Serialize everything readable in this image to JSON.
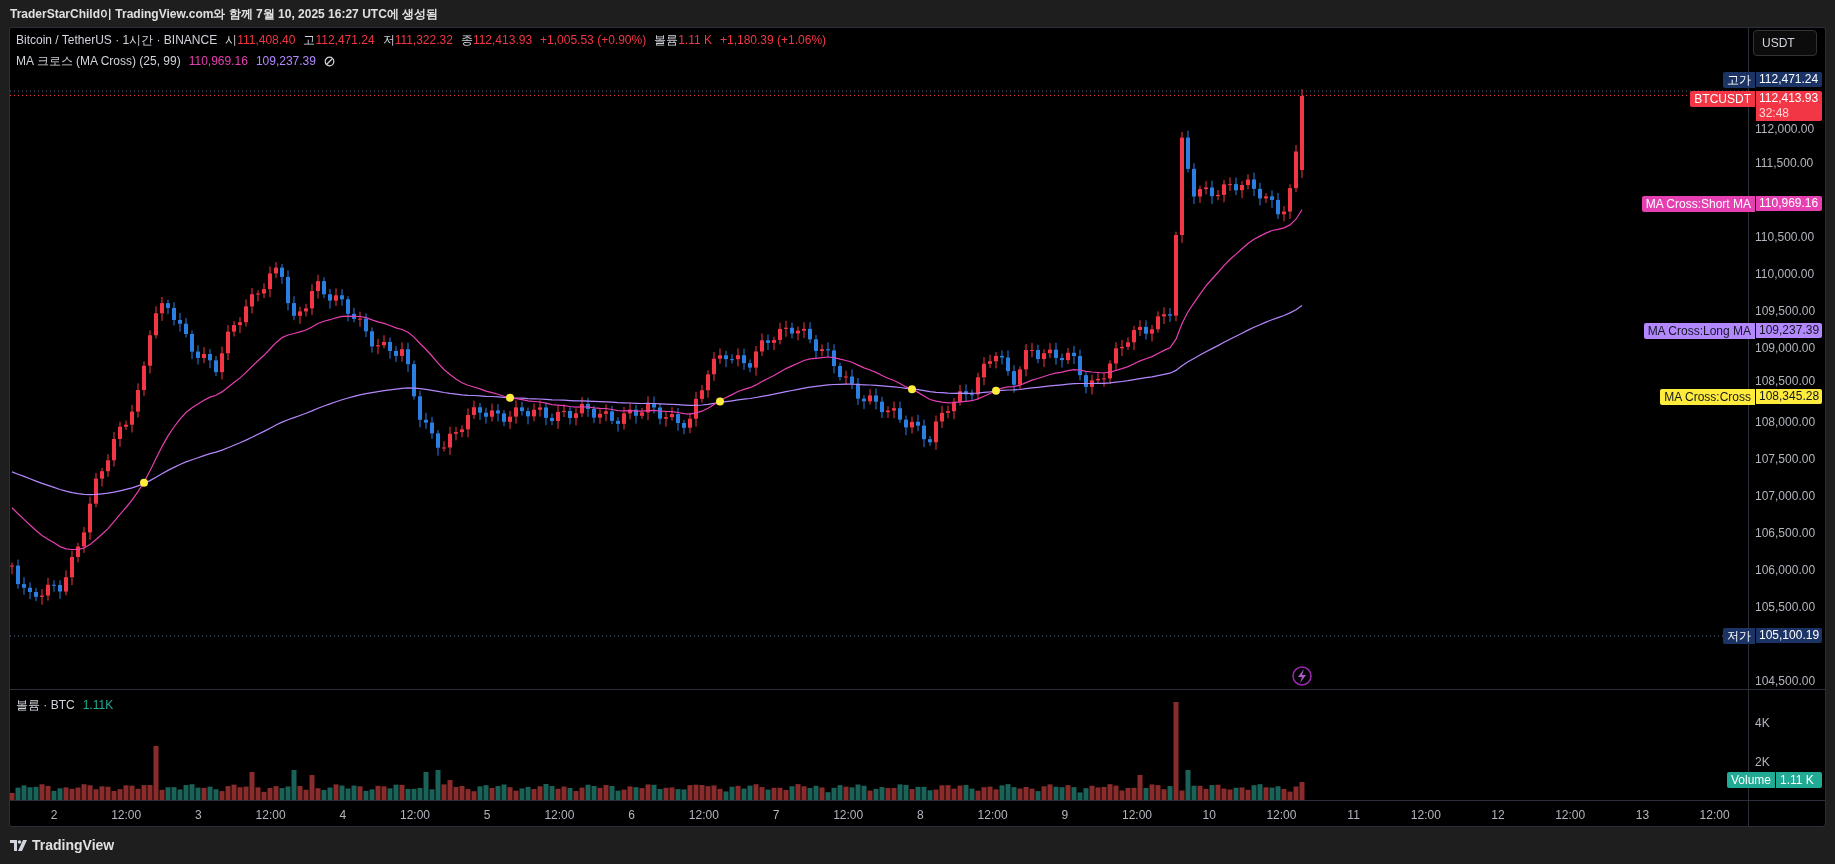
{
  "title_bar": {
    "text": "TraderStarChild이 TradingView.com와 함께 7월 10, 2025 16:27 UTC에 생성됨"
  },
  "legend": {
    "symbol": "Bitcoin / TetherUS · 1시간 · BINANCE",
    "ohlc": [
      {
        "label": "시",
        "value": "111,408.40"
      },
      {
        "label": "고",
        "value": "112,471.24"
      },
      {
        "label": "저",
        "value": "111,322.32"
      },
      {
        "label": "종",
        "value": "112,413.93"
      }
    ],
    "change": "+1,005.53 (+0.90%)",
    "volume_label": "볼륨",
    "volume": "1.11 K",
    "volume_change": "+1,180.39 (+1.06%)"
  },
  "indicator": {
    "name": "MA 크로스 (MA Cross) (25, 99)",
    "values": [
      {
        "value": "110,969.16",
        "color": "#e53fb1"
      },
      {
        "value": "109,237.39",
        "color": "#b388ff"
      }
    ]
  },
  "currency_button": "USDT",
  "price_axis": {
    "ticks": [
      "112,000.00",
      "111,500.00",
      "110,500.00",
      "110,000.00",
      "109,500.00",
      "109,000.00",
      "108,500.00",
      "108,000.00",
      "107,500.00",
      "107,000.00",
      "106,500.00",
      "106,000.00",
      "105,500.00",
      "104,500.00"
    ]
  },
  "price_tags": [
    {
      "label": "고가",
      "value": "112,471.24",
      "color": "#1c3366"
    },
    {
      "label": "BTCUSDT",
      "value": "112,413.93",
      "countdown": "32:48",
      "color": "#f23645"
    },
    {
      "label": "MA Cross:Short MA",
      "value": "110,969.16",
      "color": "#e53fb1"
    },
    {
      "label": "MA Cross:Long MA",
      "value": "109,237.39",
      "color": "#b388ff"
    },
    {
      "label": "MA Cross:Cross",
      "value": "108,345.28",
      "color": "#ffeb3b"
    },
    {
      "label": "저가",
      "value": "105,100.19",
      "color": "#1c3366"
    }
  ],
  "volume_pane": {
    "title": "볼륨 · BTC",
    "value": "1.11K",
    "axis_ticks": [
      "4K",
      "2K"
    ],
    "tag": {
      "label": "Volume",
      "value": "1.11 K",
      "color": "#22ab94"
    }
  },
  "time_axis": [
    "2",
    "12:00",
    "3",
    "12:00",
    "4",
    "12:00",
    "5",
    "12:00",
    "6",
    "12:00",
    "7",
    "12:00",
    "8",
    "12:00",
    "9",
    "12:00",
    "10",
    "12:00",
    "11",
    "12:00",
    "12",
    "12:00",
    "13",
    "12:00"
  ],
  "footer": {
    "brand": "TradingView"
  }
}
